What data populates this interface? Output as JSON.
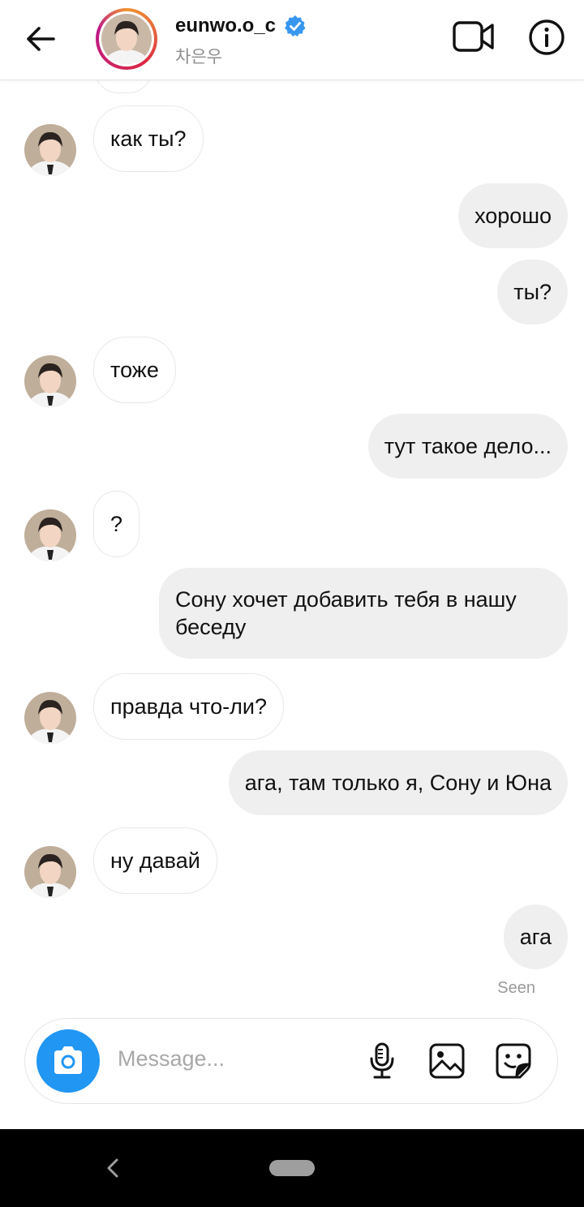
{
  "header": {
    "username": "eunwo.o_c",
    "real_name": "차은우",
    "back_icon": "arrow-left-icon",
    "video_icon": "video-camera-icon",
    "info_icon": "info-icon",
    "verified_icon": "verified-badge-icon",
    "verified_color": "#3897f0"
  },
  "messages": [
    {
      "id": "m1",
      "direction": "in",
      "text": "как ты?"
    },
    {
      "id": "m2",
      "direction": "out",
      "text": "хорошо"
    },
    {
      "id": "m3",
      "direction": "out",
      "text": "ты?"
    },
    {
      "id": "m4",
      "direction": "in",
      "text": "тоже"
    },
    {
      "id": "m5",
      "direction": "out",
      "text": "тут такое дело..."
    },
    {
      "id": "m6",
      "direction": "in",
      "text": "?"
    },
    {
      "id": "m7",
      "direction": "out",
      "text": "Сону хочет добавить тебя в нашу беседу"
    },
    {
      "id": "m8",
      "direction": "in",
      "text": "правда что-ли?"
    },
    {
      "id": "m9",
      "direction": "out",
      "text": "ага, там только я, Сону и Юна"
    },
    {
      "id": "m10",
      "direction": "in",
      "text": "ну давай"
    },
    {
      "id": "m11",
      "direction": "out",
      "text": "ага"
    }
  ],
  "seen_label": "Seen",
  "composer": {
    "placeholder": "Message...",
    "camera_icon": "camera-icon",
    "mic_icon": "microphone-icon",
    "gallery_icon": "image-gallery-icon",
    "sticker_icon": "sticker-icon",
    "camera_color": "#2196f3"
  },
  "colors": {
    "incoming_bubble": "#ffffff",
    "outgoing_bubble": "#efeff0",
    "avatar_ring": "#dc2743"
  }
}
